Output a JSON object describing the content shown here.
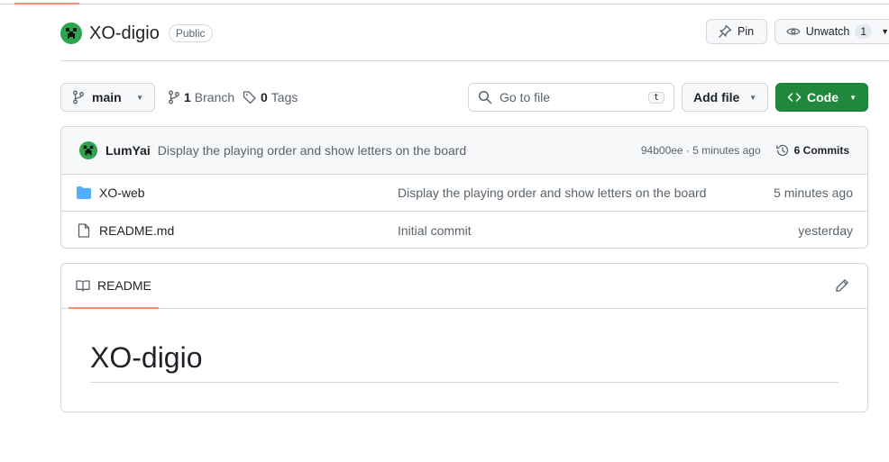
{
  "repo": {
    "name": "XO-digio",
    "visibility": "Public"
  },
  "actions": {
    "pin_label": "Pin",
    "watch_label": "Unwatch",
    "watch_count": "1"
  },
  "toolbar": {
    "branch_name": "main",
    "branch_count": "1",
    "branch_word": "Branch",
    "tag_count": "0",
    "tag_word": "Tags",
    "search_placeholder": "Go to file",
    "search_shortcut": "t",
    "add_file_label": "Add file",
    "code_label": "Code"
  },
  "commit": {
    "author": "LumYai",
    "message": "Display the playing order and show letters on the board",
    "sha_time": "94b00ee · 5 minutes ago",
    "commits_label": "6 Commits"
  },
  "files": [
    {
      "type": "folder",
      "name": "XO-web",
      "message": "Display the playing order and show letters on the board",
      "time": "5 minutes ago"
    },
    {
      "type": "file",
      "name": "README.md",
      "message": "Initial commit",
      "time": "yesterday"
    }
  ],
  "readme": {
    "tab_label": "README",
    "heading": "XO-digio"
  },
  "colors": {
    "accent_underline": "#fd8c73",
    "code_button": "#1f883d",
    "folder": "#54aeff"
  }
}
